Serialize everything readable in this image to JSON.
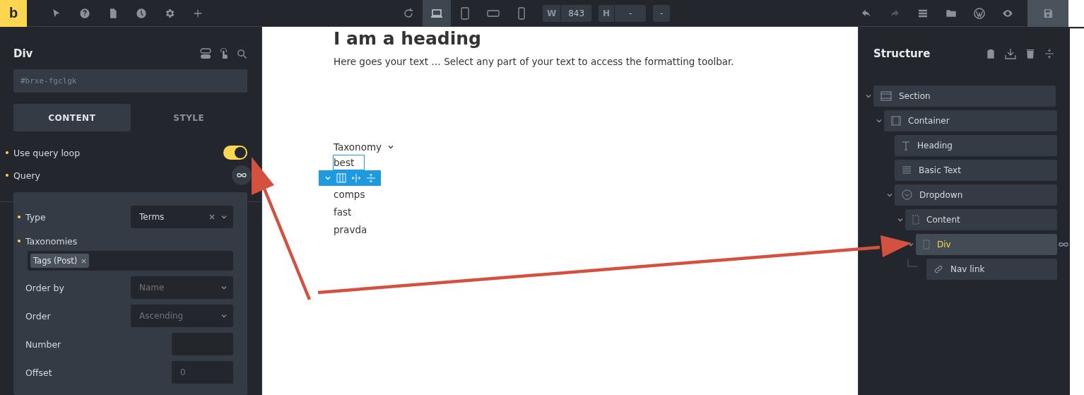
{
  "topbar": {
    "logo": "b",
    "devices": [
      {
        "kind": "laptop",
        "selected": true
      },
      {
        "kind": "tablet",
        "selected": false
      },
      {
        "kind": "landscape",
        "selected": false
      },
      {
        "kind": "phone",
        "selected": false
      }
    ],
    "width": {
      "label": "W",
      "value": "843"
    },
    "height": {
      "label": "H",
      "value": "-"
    },
    "extra": "-"
  },
  "left_panel": {
    "title": "Div",
    "id_field": {
      "placeholder": "#brxe-fgclgk"
    },
    "tabs": [
      {
        "label": "CONTENT",
        "selected": true
      },
      {
        "label": "STYLE",
        "selected": false
      }
    ],
    "use_query_loop": {
      "label": "Use query loop",
      "on": true,
      "modified": true
    },
    "query": {
      "label": "Query",
      "modified": true,
      "fields": [
        {
          "kind": "select",
          "label": "Type",
          "modified": true,
          "value": "Terms"
        },
        {
          "kind": "tags",
          "label": "Taxonomies",
          "modified": true,
          "tags": [
            "Tags (Post)"
          ]
        },
        {
          "kind": "select",
          "label": "Order by",
          "modified": false,
          "placeholder": "Name"
        },
        {
          "kind": "select",
          "label": "Order",
          "modified": false,
          "placeholder": "Ascending"
        },
        {
          "kind": "number",
          "label": "Number",
          "modified": false
        },
        {
          "kind": "number",
          "label": "Offset",
          "modified": false,
          "placeholder": "0"
        }
      ]
    }
  },
  "canvas": {
    "heading": "I am a heading",
    "text": "Here goes your text … Select any part of your text to access the formatting toolbar.",
    "dropdown": {
      "label": "Taxonomy",
      "items": [
        {
          "label": "best",
          "selected": true
        },
        {
          "label": "comps",
          "selected": false
        },
        {
          "label": "fast",
          "selected": false
        },
        {
          "label": "pravda",
          "selected": false
        }
      ]
    }
  },
  "structure": {
    "title": "Structure",
    "tree": [
      {
        "label": "Section",
        "kind": "section",
        "expanded": true,
        "selected": false,
        "children": [
          {
            "label": "Container",
            "kind": "container",
            "expanded": true,
            "selected": false,
            "children": [
              {
                "label": "Heading",
                "kind": "heading",
                "selected": false
              },
              {
                "label": "Basic Text",
                "kind": "text",
                "selected": false
              },
              {
                "label": "Dropdown",
                "kind": "dropdown",
                "expanded": true,
                "selected": false,
                "children": [
                  {
                    "label": "Content",
                    "kind": "div",
                    "expanded": true,
                    "selected": false,
                    "children": [
                      {
                        "label": "Div",
                        "kind": "div",
                        "expanded": true,
                        "selected": true,
                        "query_loop": true,
                        "children": [
                          {
                            "label": "Nav link",
                            "kind": "link",
                            "selected": false
                          }
                        ]
                      }
                    ]
                  }
                ]
              }
            ]
          }
        ]
      }
    ]
  }
}
